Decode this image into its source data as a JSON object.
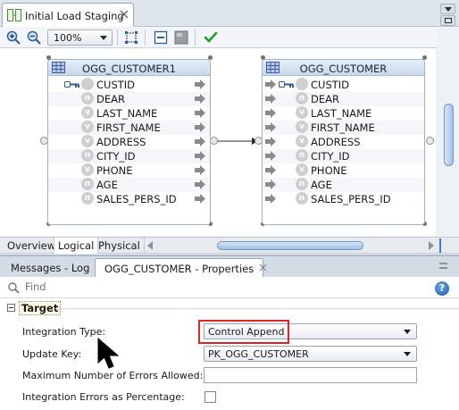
{
  "editor": {
    "tab_title": "Initial Load Staging",
    "close_icon": "close-icon"
  },
  "toolbar": {
    "zoom_value": "100%",
    "icons": [
      "zoom-in-icon",
      "zoom-out-icon",
      "fit-icon",
      "select-icon",
      "layout-icon",
      "validate-icon"
    ]
  },
  "source_entity": {
    "title": "OGG_CUSTOMER1",
    "columns": [
      {
        "name": "CUSTID",
        "badge": "",
        "key": true
      },
      {
        "name": "DEAR",
        "badge": "n",
        "key": false
      },
      {
        "name": "LAST_NAME",
        "badge": "v",
        "key": false
      },
      {
        "name": "FIRST_NAME",
        "badge": "v",
        "key": false
      },
      {
        "name": "ADDRESS",
        "badge": "v",
        "key": false
      },
      {
        "name": "CITY_ID",
        "badge": "n",
        "key": false
      },
      {
        "name": "PHONE",
        "badge": "v",
        "key": false
      },
      {
        "name": "AGE",
        "badge": "n",
        "key": false
      },
      {
        "name": "SALES_PERS_ID",
        "badge": "n",
        "key": false
      }
    ]
  },
  "target_entity": {
    "title": "OGG_CUSTOMER",
    "columns": [
      {
        "name": "CUSTID",
        "badge": "",
        "key": true
      },
      {
        "name": "DEAR",
        "badge": "n",
        "key": false
      },
      {
        "name": "LAST_NAME",
        "badge": "v",
        "key": false
      },
      {
        "name": "FIRST_NAME",
        "badge": "v",
        "key": false
      },
      {
        "name": "ADDRESS",
        "badge": "v",
        "key": false
      },
      {
        "name": "CITY_ID",
        "badge": "n",
        "key": false
      },
      {
        "name": "PHONE",
        "badge": "v",
        "key": false
      },
      {
        "name": "AGE",
        "badge": "n",
        "key": false
      },
      {
        "name": "SALES_PERS_ID",
        "badge": "n",
        "key": false
      }
    ]
  },
  "diagram_tabs": [
    "Overview",
    "Logical",
    "Physical"
  ],
  "diagram_tabs_active": "Logical",
  "panel_tabs": [
    "Messages - Log",
    "OGG_CUSTOMER - Properties"
  ],
  "panel_tabs_active": "OGG_CUSTOMER - Properties",
  "find": {
    "placeholder": "Find"
  },
  "help_label": "?",
  "section": {
    "title": "Target",
    "toggle": "−"
  },
  "properties": {
    "integration_type": {
      "label": "Integration Type:",
      "value": "Control Append"
    },
    "update_key": {
      "label": "Update Key:",
      "value": "PK_OGG_CUSTOMER"
    },
    "max_errors": {
      "label": "Maximum Number of Errors Allowed:",
      "value": ""
    },
    "errors_pct": {
      "label": "Integration Errors as Percentage:",
      "checked": false
    }
  },
  "colors": {
    "highlight": "#e32222",
    "arrow": "#8a8a8a",
    "badge": "#cfcfcf",
    "check": "#1f9e1f"
  }
}
